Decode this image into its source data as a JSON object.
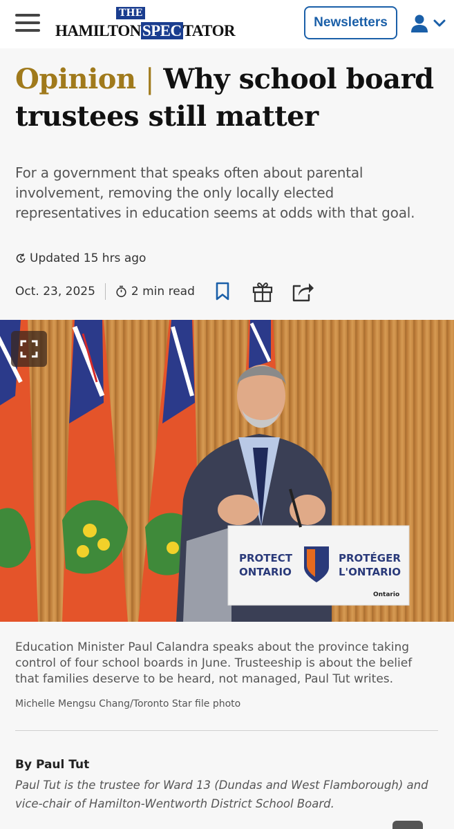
{
  "header": {
    "logo_the": "THE",
    "logo_left": "HAMILTON",
    "logo_spec": "SPEC",
    "logo_right": "TATOR",
    "newsletters_label": "Newsletters"
  },
  "article": {
    "kicker": "Opinion",
    "separator": "|",
    "title": "Why school board trustees still matter",
    "dek": "For a government that speaks often about parental involvement, removing the only locally elected representatives in education seems at odds with that goal.",
    "updated": "Updated 15 hrs ago",
    "date": "Oct. 23, 2025",
    "read_time": "2 min read",
    "photo_sign_left_1": "PROTECT",
    "photo_sign_left_2": "ONTARIO",
    "photo_sign_right_1": "PROTÉGER",
    "photo_sign_right_2": "L'ONTARIO",
    "photo_sign_small": "Ontario",
    "caption": "Education Minister Paul Calandra speaks about the province taking control of four school boards in June. Trusteeship is about the belief that families deserve to be heard, not managed, Paul Tut writes.",
    "credit": "Michelle Mengsu Chang/Toronto Star file photo",
    "byline": "By Paul Tut",
    "bio": "Paul Tut is the trustee for Ward 13 (Dundas and West Flamborough) and vice-chair of Hamilton-Wentworth District School Board."
  },
  "colors": {
    "accent": "#1a5fa8",
    "kicker": "#a07a1c",
    "brand_blue": "#1a3d8f"
  },
  "icons": [
    "menu-icon",
    "user-icon",
    "chevron-down-icon",
    "clock-refresh-icon",
    "timer-icon",
    "bookmark-icon",
    "gift-icon",
    "share-icon",
    "expand-icon"
  ]
}
